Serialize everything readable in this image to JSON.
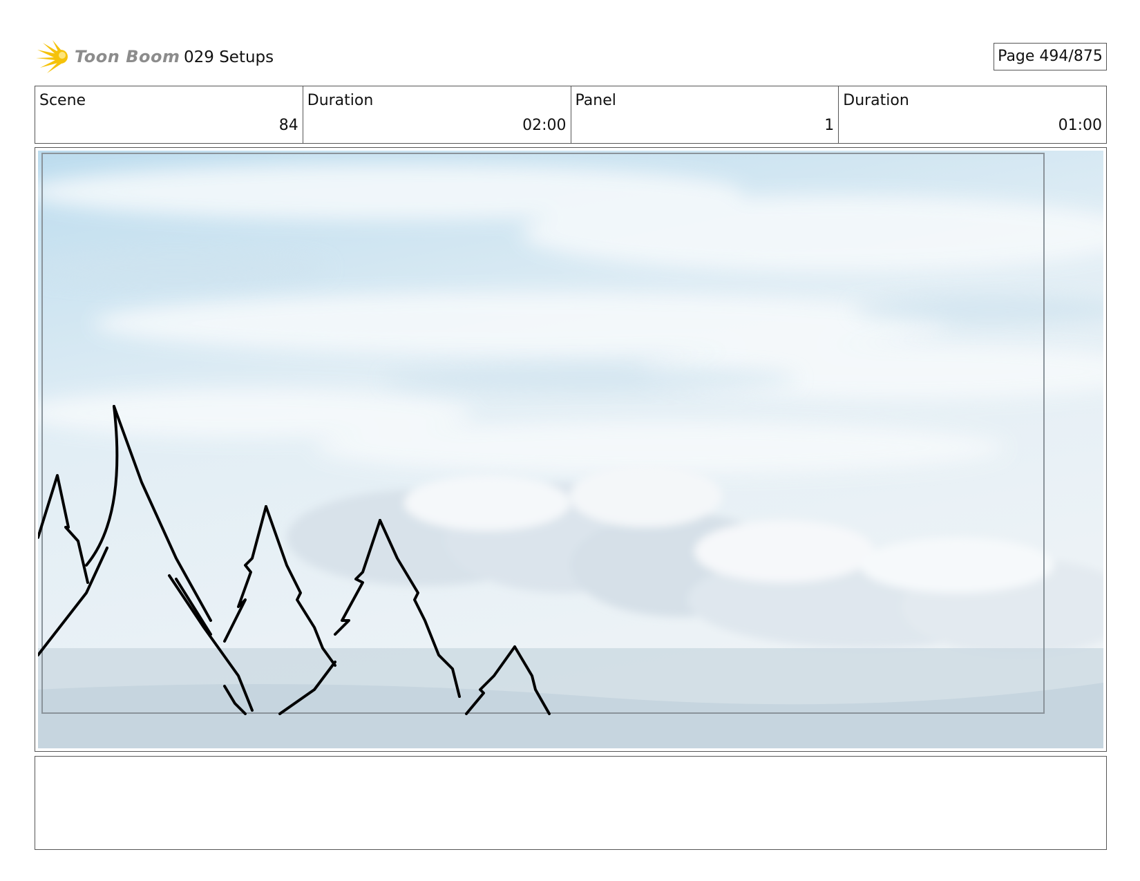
{
  "header": {
    "brand": "Toon Boom",
    "title": "029 Setups",
    "page_counter": "Page 494/875"
  },
  "info_table": [
    {
      "label": "Scene",
      "value": "84"
    },
    {
      "label": "Duration",
      "value": "02:00"
    },
    {
      "label": "Panel",
      "value": "1"
    },
    {
      "label": "Duration",
      "value": "01:00"
    }
  ],
  "caption": "",
  "colors": {
    "logo_sun": "#f5c20a",
    "logo_text": "#8c8c8c",
    "sky_top": "#bcdcee",
    "cloud": "#f2f6f9",
    "horizon": "#c9d6e0",
    "sketch_stroke": "#000000"
  }
}
